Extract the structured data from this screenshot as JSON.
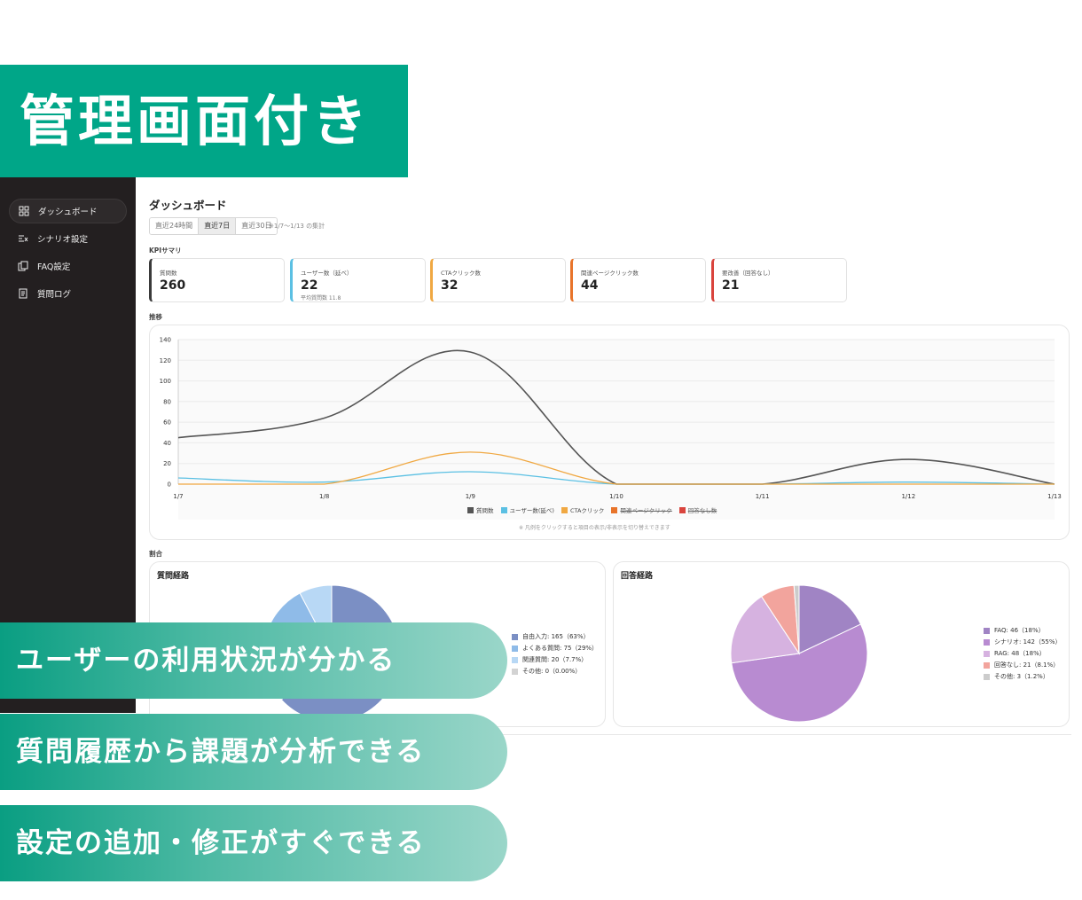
{
  "banner": {
    "title": "管理画面付き"
  },
  "features": [
    "ユーザーの利用状況が分かる",
    "質問履歴から課題が分析できる",
    "設定の追加・修正がすぐできる"
  ],
  "sidebar": {
    "items": [
      {
        "label": "ダッシュボード",
        "icon": "dashboard-grid-icon",
        "active": true
      },
      {
        "label": "シナリオ設定",
        "icon": "scenario-list-icon",
        "active": false
      },
      {
        "label": "FAQ設定",
        "icon": "faq-copy-icon",
        "active": false
      },
      {
        "label": "質問ログ",
        "icon": "log-document-icon",
        "active": false
      }
    ]
  },
  "page": {
    "title": "ダッシュボード",
    "ranges": [
      "直近24時間",
      "直近7日",
      "直近30日"
    ],
    "active_range": "直近7日",
    "range_note": "※1/7〜1/13 の集計",
    "kpi_label": "KPIサマリ",
    "trend_label": "推移",
    "ratio_label": "割合"
  },
  "kpis": [
    {
      "label": "質問数",
      "value": "260",
      "sub": "",
      "color": "#3a3a3a"
    },
    {
      "label": "ユーザー数（延べ）",
      "value": "22",
      "sub": "平均質問数 11.8",
      "color": "#5bc0e3"
    },
    {
      "label": "CTAクリック数",
      "value": "32",
      "sub": "",
      "color": "#f0a842"
    },
    {
      "label": "関連ページクリック数",
      "value": "44",
      "sub": "",
      "color": "#e8742a"
    },
    {
      "label": "要改善（回答なし）",
      "value": "21",
      "sub": "",
      "color": "#d9443d"
    }
  ],
  "chart_data": [
    {
      "type": "line",
      "x": [
        "1/7",
        "1/8",
        "1/9",
        "1/10",
        "1/11",
        "1/12",
        "1/13"
      ],
      "ylim": [
        0,
        140
      ],
      "yticks": [
        0,
        20,
        40,
        60,
        80,
        100,
        120,
        140
      ],
      "grid": true,
      "smooth": true,
      "legend_position": "bottom",
      "series": [
        {
          "name": "質問数",
          "values": [
            45,
            64,
            128,
            0,
            0,
            24,
            0
          ],
          "color": "#555555",
          "visible": true
        },
        {
          "name": "ユーザー数(延べ)",
          "values": [
            6,
            2,
            12,
            0,
            0,
            2,
            0
          ],
          "color": "#5bc0e3",
          "visible": true
        },
        {
          "name": "CTAクリック",
          "values": [
            0,
            0,
            31,
            0,
            0,
            0,
            0
          ],
          "color": "#f0a842",
          "visible": true
        },
        {
          "name": "関連ページクリック",
          "values": [],
          "color": "#e8742a",
          "visible": false
        },
        {
          "name": "回答なし数",
          "values": [],
          "color": "#d9443d",
          "visible": false
        }
      ],
      "hint": "※ 凡例をクリックすると項目の表示/非表示を切り替えできます"
    },
    {
      "type": "pie",
      "title": "質問経路",
      "slices": [
        {
          "label": "自由入力: 165（63%）",
          "value": 63,
          "color": "#7b8fc4"
        },
        {
          "label": "よくある質問: 75（29%）",
          "value": 29,
          "color": "#8fbbe8"
        },
        {
          "label": "関連質問: 20（7.7%）",
          "value": 7.7,
          "color": "#b8d8f5"
        },
        {
          "label": "その他: 0（0.00%）",
          "value": 0,
          "color": "#d3d3d3"
        }
      ]
    },
    {
      "type": "pie",
      "title": "回答経路",
      "slices": [
        {
          "label": "FAQ: 46（18%）",
          "value": 18,
          "color": "#a084c4"
        },
        {
          "label": "シナリオ: 142（55%）",
          "value": 55,
          "color": "#b88bd1"
        },
        {
          "label": "RAG: 48（18%）",
          "value": 18,
          "color": "#d6b2e0"
        },
        {
          "label": "回答なし: 21（8.1%）",
          "value": 8.1,
          "color": "#f2a49d"
        },
        {
          "label": "その他: 3（1.2%）",
          "value": 1.2,
          "color": "#cccccc"
        }
      ]
    }
  ]
}
